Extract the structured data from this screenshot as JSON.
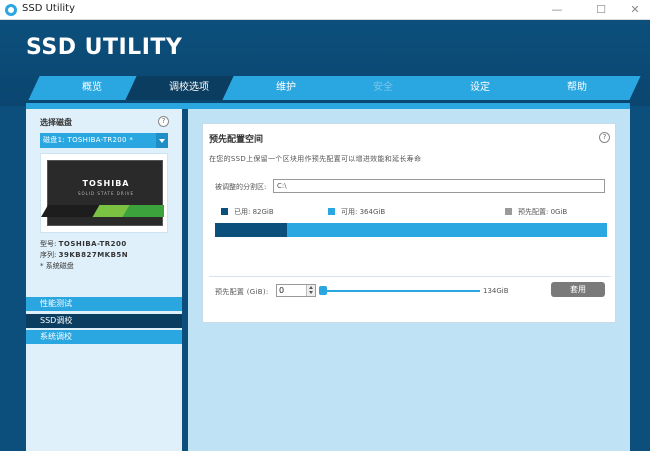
{
  "window": {
    "title": "SSD Utility",
    "minimize": "—",
    "maximize": "☐",
    "close": "✕"
  },
  "header": {
    "logo": "SSD UTILITY"
  },
  "tabs": [
    {
      "label": "概览",
      "state": "normal"
    },
    {
      "label": "调校选项",
      "state": "active"
    },
    {
      "label": "维护",
      "state": "normal"
    },
    {
      "label": "安全",
      "state": "disabled"
    },
    {
      "label": "设定",
      "state": "normal"
    },
    {
      "label": "帮助",
      "state": "normal"
    }
  ],
  "sidebar": {
    "select_label": "选择磁盘",
    "help_glyph": "?",
    "drive_value": "磁盘1: TOSHIBA-TR200 *",
    "drive_image": {
      "brand": "TOSHIBA",
      "subtitle": "SOLID STATE DRIVE"
    },
    "model_label": "型号:",
    "model_value": "TOSHIBA-TR200",
    "serial_label": "序列:",
    "serial_value": "39KB827MKB5N",
    "system_note": "* 系统磁盘",
    "menu": [
      {
        "label": "性能测试",
        "style": "light"
      },
      {
        "label": "SSD调校",
        "style": "dark"
      },
      {
        "label": "系统调校",
        "style": "light"
      }
    ]
  },
  "panel": {
    "title": "预先配置空间",
    "help_glyph": "?",
    "description": "在您的SSD上保留一个区块用作预先配置可以增进效能和延长寿命",
    "partition_label": "被调整的分割区:",
    "partition_value": "C:\\",
    "legend": [
      {
        "label": "已用:",
        "value": "82GiB",
        "color": "#0b4f7c"
      },
      {
        "label": "可用:",
        "value": "364GiB",
        "color": "#2aa6e0"
      },
      {
        "label": "预先配置:",
        "value": "0GiB",
        "color": "#9a9a9a"
      }
    ],
    "usage": {
      "used_gib": 82,
      "free_gib": 364,
      "provisioned_gib": 0
    },
    "op_label": "预先配置 (GiB):",
    "op_value": "0",
    "slider_fraction": 0,
    "slider_max": "134GiB",
    "apply_label": "套用"
  }
}
